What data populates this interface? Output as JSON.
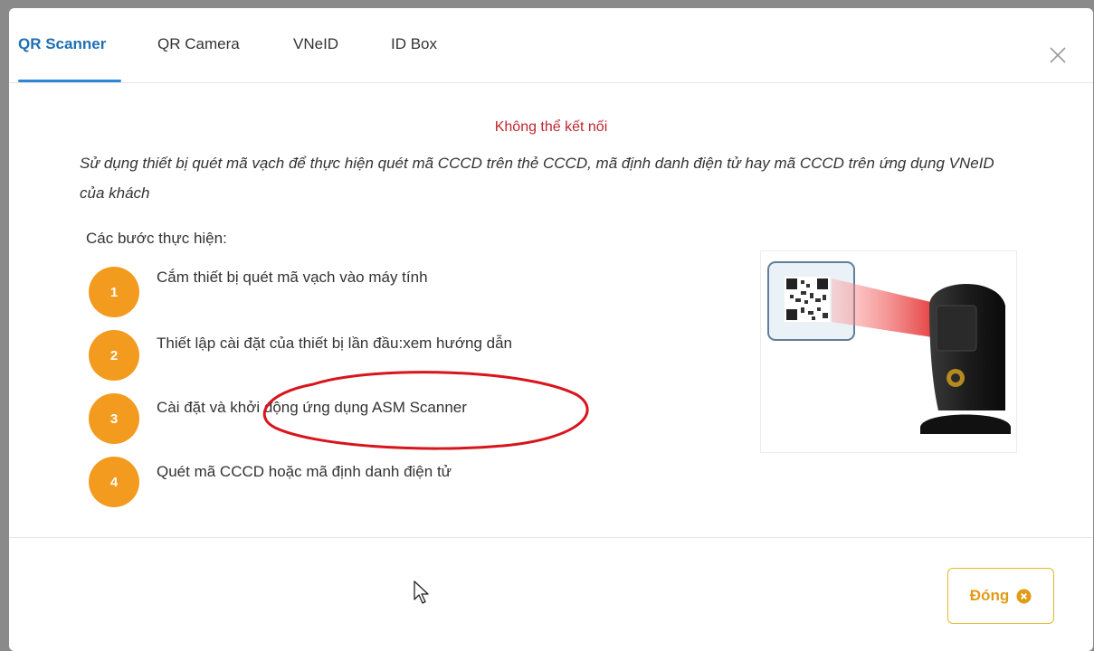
{
  "tabs": [
    {
      "label": "QR Scanner",
      "active": true
    },
    {
      "label": "QR Camera",
      "active": false
    },
    {
      "label": "VNeID",
      "active": false
    },
    {
      "label": "ID Box",
      "active": false
    }
  ],
  "status": "Không thể kết nối",
  "description": "Sử dụng thiết bị quét mã vạch để thực hiện quét mã CCCD trên thẻ CCCD, mã định danh điện tử hay mã CCCD trên ứng dụng VNeID của khách",
  "steps_heading": "Các bước thực hiện:",
  "steps": [
    {
      "number": "1",
      "text": "Cắm thiết bị quét mã vạch vào máy tính"
    },
    {
      "number": "2",
      "text": "Thiết lập cài đặt của thiết bị lần đầu:",
      "link": "xem hướng dẫn"
    },
    {
      "number": "3",
      "text": "Cài đặt và khởi động ứng dụng ASM Scanner"
    },
    {
      "number": "4",
      "text": "Quét mã CCCD hoặc mã định danh điện tử"
    }
  ],
  "footer": {
    "close_label": "Đóng"
  },
  "colors": {
    "accent": "#2f86d6",
    "step": "#f29b1f",
    "error": "#c0272d",
    "annotation": "#d8141c"
  }
}
